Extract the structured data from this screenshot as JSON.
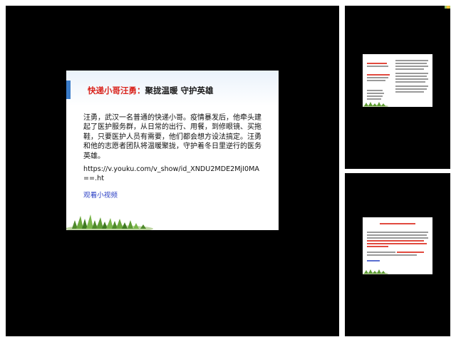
{
  "main_slide": {
    "title_red": "快递小哥汪勇：",
    "title_dark": "聚拢温暖 守护英雄",
    "body": "汪勇，武汉一名普通的快递小哥。疫情暴发后，他牵头建起了医护服务群，从日常的出行、用餐，到修眼镜、买拖鞋，只要医护人员有需要，他们都会想方设法搞定。汪勇和他的志愿者团队将温暖聚拢，守护着冬日里逆行的医务英雄。",
    "video_url": "https://v.youku.com/v_show/id_XNDU2MDE2MjI0MA==.ht",
    "video_link_label": "观看小视频"
  },
  "thumbnails": [
    {
      "label": "slide-thumbnail-2"
    },
    {
      "label": "slide-thumbnail-3"
    }
  ],
  "colors": {
    "title_red": "#d9231c",
    "link_blue": "#2a3fc4",
    "background": "#000000"
  }
}
